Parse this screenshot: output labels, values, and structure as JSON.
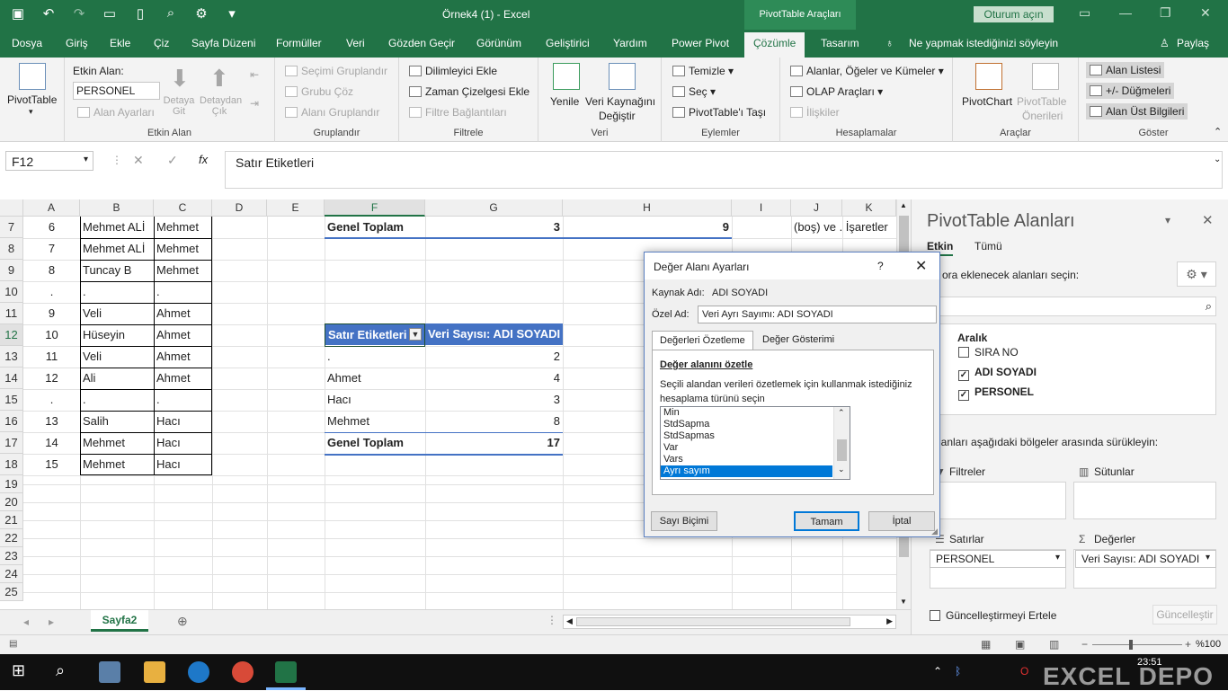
{
  "window": {
    "title": "Örnek4 (1)  -  Excel",
    "context_title": "PivotTable Araçları",
    "login_label": "Oturum açın"
  },
  "tabs": [
    "Dosya",
    "Giriş",
    "Ekle",
    "Çiz",
    "Sayfa Düzeni",
    "Formüller",
    "Veri",
    "Gözden Geçir",
    "Görünüm",
    "Geliştirici",
    "Yardım",
    "Power Pivot",
    "Çözümle",
    "Tasarım"
  ],
  "active_tab": "Çözümle",
  "tell_me": "Ne yapmak istediğinizi söyleyin",
  "share_label": "Paylaş",
  "ribbon": {
    "pivottable_label": "PivotTable",
    "active_field": {
      "label": "Etkin Alan:",
      "value": "PERSONEL",
      "field_settings": "Alan Ayarları",
      "drill_down": "Detaya Git",
      "drill_up": "Detaydan Çık",
      "group_label": "Etkin Alan"
    },
    "group": {
      "group_selection": "Seçimi Gruplandır",
      "ungroup": "Grubu Çöz",
      "group_field": "Alanı Gruplandır",
      "group_label": "Gruplandır"
    },
    "filter": {
      "insert_slicer": "Dilimleyici Ekle",
      "insert_timeline": "Zaman Çizelgesi Ekle",
      "filter_connections": "Filtre Bağlantıları",
      "group_label": "Filtrele"
    },
    "data": {
      "refresh": "Yenile",
      "change_source_1": "Veri Kaynağını",
      "change_source_2": "Değiştir",
      "group_label": "Veri"
    },
    "actions": {
      "clear": "Temizle",
      "select": "Seç",
      "move": "PivotTable'ı Taşı",
      "group_label": "Eylemler"
    },
    "calculations": {
      "fields_items": "Alanlar, Öğeler ve Kümeler",
      "olap": "OLAP Araçları",
      "relationships": "İlişkiler",
      "group_label": "Hesaplamalar"
    },
    "tools": {
      "pivotchart": "PivotChart",
      "recommended_1": "PivotTable",
      "recommended_2": "Önerileri",
      "group_label": "Araçlar"
    },
    "show": {
      "field_list": "Alan Listesi",
      "buttons": "+/- Düğmeleri",
      "headers": "Alan Üst Bilgileri",
      "group_label": "Göster"
    }
  },
  "formula_bar": {
    "name_box": "F12",
    "fx": "fx",
    "content": "Satır Etiketleri"
  },
  "columns": [
    "A",
    "B",
    "C",
    "D",
    "E",
    "F",
    "G",
    "H",
    "I",
    "J",
    "K"
  ],
  "rows": [
    {
      "num": "7",
      "a": "6",
      "b": "Mehmet ALİ",
      "c": "Mehmet"
    },
    {
      "num": "8",
      "a": "7",
      "b": "Mehmet ALİ",
      "c": "Mehmet"
    },
    {
      "num": "9",
      "a": "8",
      "b": "Tuncay B",
      "c": "Mehmet"
    },
    {
      "num": "10",
      "a": ".",
      "b": ".",
      "c": "."
    },
    {
      "num": "11",
      "a": "9",
      "b": "Veli",
      "c": "Ahmet"
    },
    {
      "num": "12",
      "a": "10",
      "b": "Hüseyin",
      "c": "Ahmet"
    },
    {
      "num": "13",
      "a": "11",
      "b": "Veli",
      "c": "Ahmet"
    },
    {
      "num": "14",
      "a": "12",
      "b": "Ali",
      "c": "Ahmet"
    },
    {
      "num": "15",
      "a": ".",
      "b": ".",
      "c": "."
    },
    {
      "num": "16",
      "a": "13",
      "b": "Salih",
      "c": "Hacı"
    },
    {
      "num": "17",
      "a": "14",
      "b": "Mehmet",
      "c": "Hacı"
    },
    {
      "num": "18",
      "a": "15",
      "b": "Mehmet",
      "c": "Hacı"
    },
    {
      "num": "19"
    },
    {
      "num": "20"
    },
    {
      "num": "21"
    },
    {
      "num": "22"
    },
    {
      "num": "23"
    },
    {
      "num": "24"
    },
    {
      "num": "25"
    }
  ],
  "top_pivot": {
    "label": "Genel Toplam",
    "g": "3",
    "h": "9",
    "j": "(boş) ve . İşaretler"
  },
  "pivot": {
    "header_row": "Satır Etiketleri",
    "header_values": "Veri Sayısı: ADI SOYADI",
    "items": [
      {
        "label": ".",
        "value": "2"
      },
      {
        "label": "Ahmet",
        "value": "4"
      },
      {
        "label": "Hacı",
        "value": "3"
      },
      {
        "label": "Mehmet",
        "value": "8"
      }
    ],
    "total_label": "Genel Toplam",
    "total_value": "17"
  },
  "sheet": {
    "tab": "Sayfa2"
  },
  "status": {
    "zoom": "%100"
  },
  "pane": {
    "title": "PivotTable Alanları",
    "tab_active": "Etkin",
    "tab_all": "Tümü",
    "choose_fields": "ora eklenecek alanları seçin:",
    "source": "Aralık",
    "fields": [
      {
        "name": "SIRA NO",
        "checked": false
      },
      {
        "name": "ADI SOYADI",
        "checked": true
      },
      {
        "name": "PERSONEL",
        "checked": true
      }
    ],
    "drag_text": "lanları aşağıdaki bölgeler arasında sürükleyin:",
    "filters": "Filtreler",
    "columns": "Sütunlar",
    "rows": "Satırlar",
    "values": "Değerler",
    "rows_item": "PERSONEL",
    "values_item": "Veri Sayısı: ADI SOYADI",
    "defer": "Güncelleştirmeyi Ertele",
    "update": "Güncelleştir"
  },
  "dialog": {
    "title": "Değer Alanı Ayarları",
    "help": "?",
    "source_label": "Kaynak Adı:",
    "source_value": "ADI SOYADI",
    "custom_label": "Özel Ad:",
    "custom_value": "Veri Ayrı Sayımı: ADI SOYADI",
    "tab_summarize": "Değerleri Özetleme",
    "tab_show": "Değer Gösterimi",
    "section_title": "Değer alanını özetle",
    "description": "Seçili alandan verileri özetlemek için kullanmak istediğiniz hesaplama türünü seçin",
    "options": [
      "Min",
      "StdSapma",
      "StdSapmas",
      "Var",
      "Vars",
      "Ayrı sayım"
    ],
    "selected": "Ayrı sayım",
    "number_format": "Sayı Biçimi",
    "ok": "Tamam",
    "cancel": "İptal"
  },
  "watermark": "EXCEL DEPO"
}
